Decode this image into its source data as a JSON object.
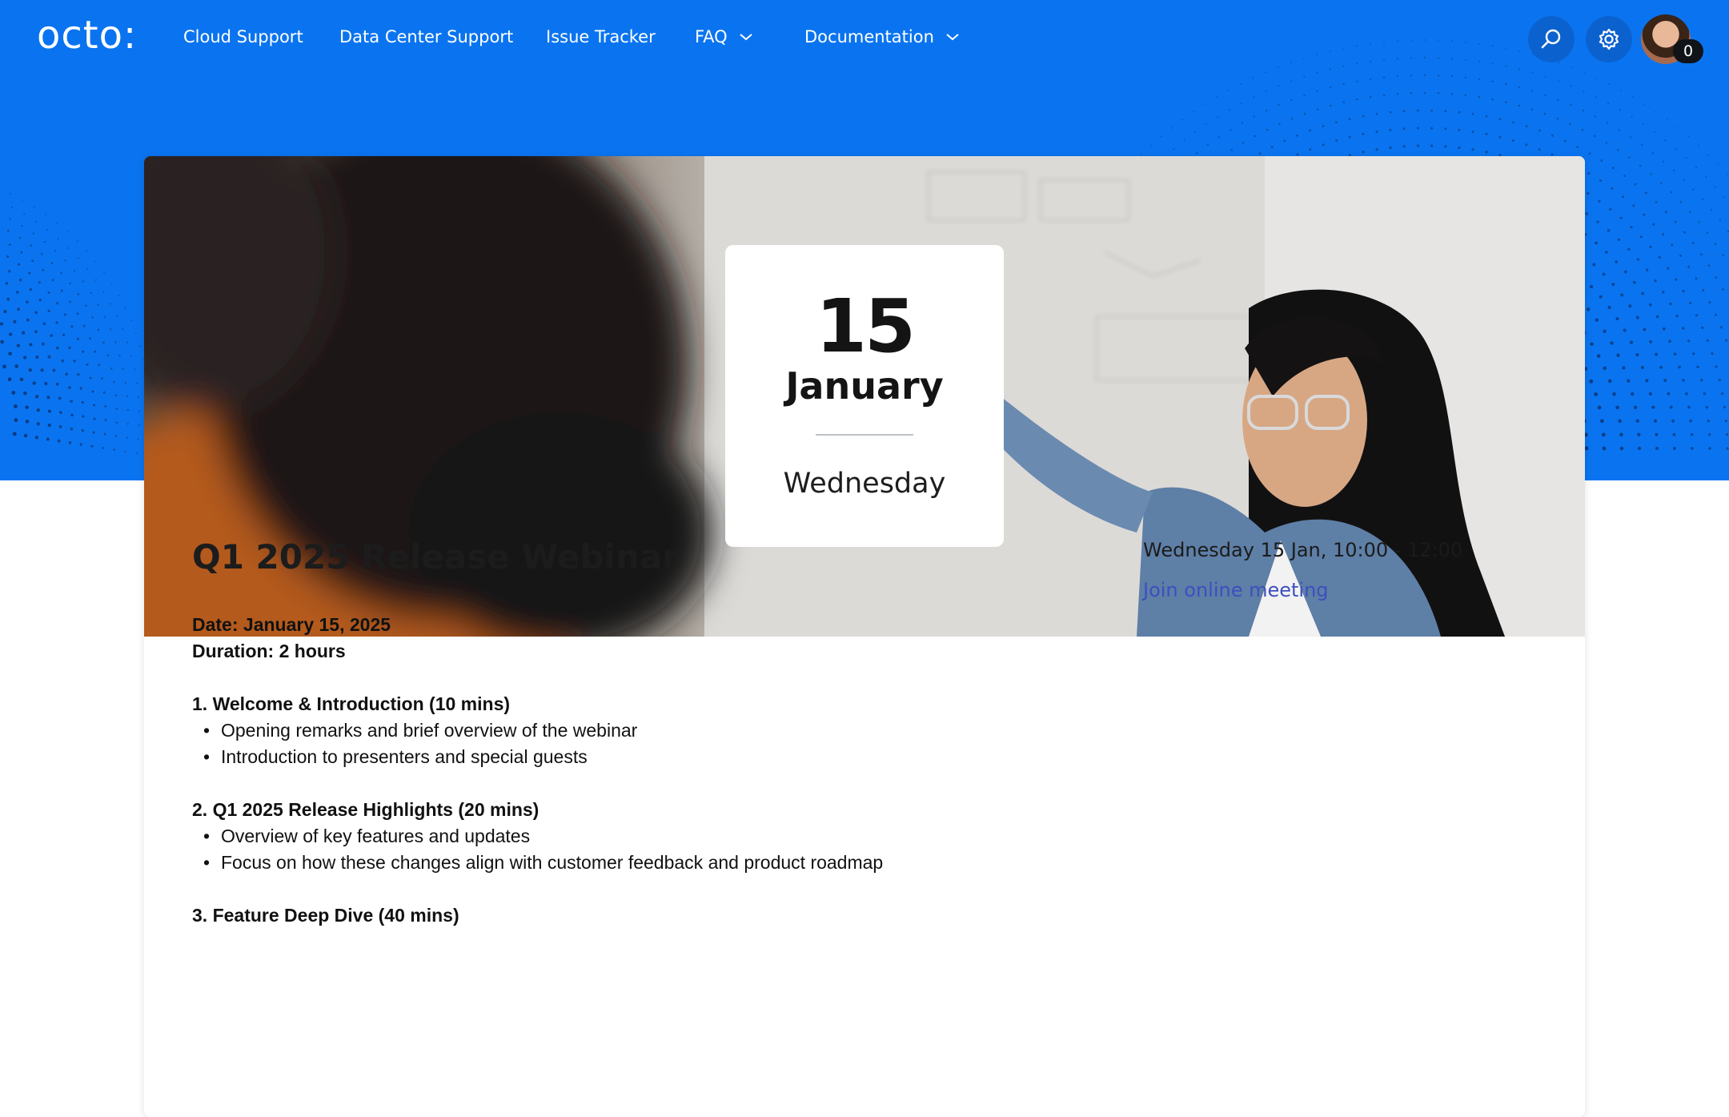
{
  "nav": {
    "logo": "octo:",
    "items": [
      {
        "label": "Cloud Support"
      },
      {
        "label": "Data Center Support"
      },
      {
        "label": "Issue Tracker"
      },
      {
        "label": "FAQ"
      },
      {
        "label": "Documentation"
      }
    ],
    "notification_count": "0"
  },
  "event": {
    "day": "15",
    "month": "January",
    "weekday": "Wednesday",
    "title": "Q1 2025 Release Webinar",
    "date_line": "Date: January 15, 2025",
    "duration_line": "Duration: 2 hours",
    "sections": [
      {
        "heading": "1. Welcome & Introduction (10 mins)",
        "bullets": [
          "Opening remarks and brief overview of the webinar",
          "Introduction to presenters and special guests"
        ]
      },
      {
        "heading": "2. Q1 2025 Release Highlights (20 mins)",
        "bullets": [
          "Overview of key features and updates",
          "Focus on how these changes align with customer feedback and product roadmap"
        ]
      },
      {
        "heading": "3. Feature Deep Dive (40 mins)",
        "bullets": []
      }
    ],
    "schedule": "Wednesday 15 Jan, 10:00 - 12:00",
    "join_link": "Join online meeting"
  },
  "icons": {
    "search": "search-icon",
    "settings": "gear-icon",
    "chevron": "chevron-down-icon"
  },
  "colors": {
    "hero_blue": "#0a74f0",
    "link": "#3e4fbf"
  }
}
